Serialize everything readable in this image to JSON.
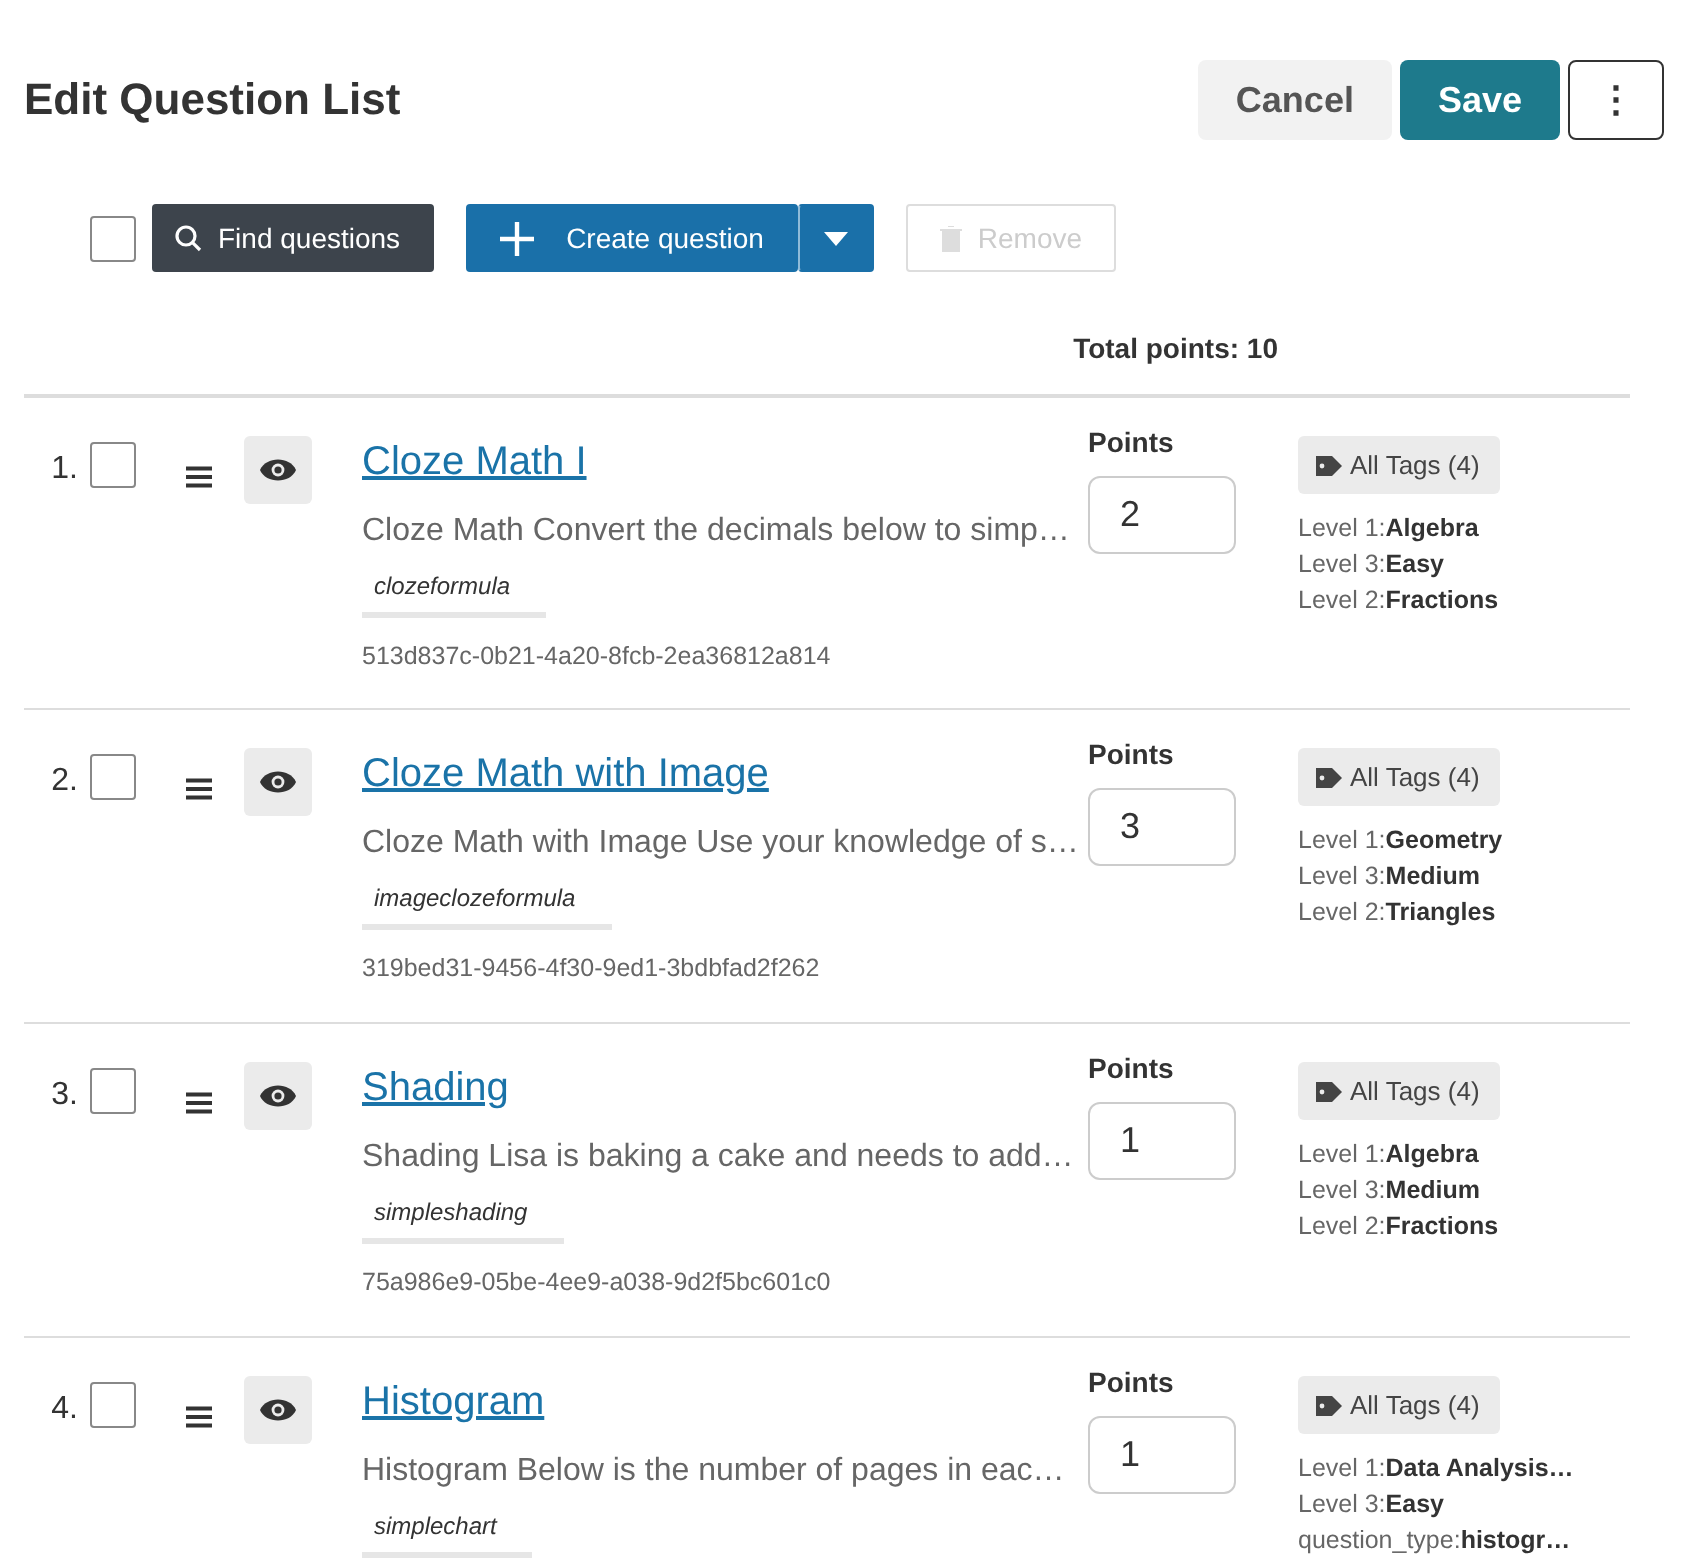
{
  "title": "Edit Question List",
  "header_buttons": [
    {
      "label": "Cancel",
      "kind": "secondary"
    },
    {
      "label": "Save",
      "kind": "primary"
    },
    {
      "label": "⋮",
      "kind": "more"
    }
  ],
  "toolbar": {
    "select_all": {
      "checked": false
    },
    "find": {
      "label": "Find questions"
    },
    "create": {
      "label": "Create question"
    },
    "remove": {
      "label": "Remove",
      "disabled": true
    }
  },
  "total_points": "Total points: 10",
  "questions": [
    {
      "number": "1.",
      "checked": false,
      "title": "Cloze Math I",
      "description": "Cloze Math Convert the decimals below to simp…",
      "type": "clozeformula",
      "id": "513d837c-0b21-4a20-8fcb-2ea36812a814",
      "points_label": "Points",
      "points": "2",
      "tags_button": "All Tags (4)",
      "tags": [
        "Level 1:**Algebra**",
        "Level 3:**Easy**",
        "Level 2:**Fractions**"
      ]
    },
    {
      "number": "2.",
      "checked": false,
      "title": "Cloze Math with Image",
      "description": "Cloze Math with Image Use your knowledge of s…",
      "type": "imageclozeformula",
      "id": "319bed31-9456-4f30-9ed1-3bdbfad2f262",
      "points_label": "Points",
      "points": "3",
      "tags_button": "All Tags (4)",
      "tags": [
        "Level 1:**Geometry**",
        "Level 3:**Medium**",
        "Level 2:**Triangles**"
      ]
    },
    {
      "number": "3.",
      "checked": false,
      "title": "Shading",
      "description": "Shading Lisa is baking a cake and needs to add…",
      "type": "simpleshading",
      "id": "75a986e9-05be-4ee9-a038-9d2f5bc601c0",
      "points_label": "Points",
      "points": "1",
      "tags_button": "All Tags (4)",
      "tags": [
        "Level 1:**Algebra**",
        "Level 3:**Medium**",
        "Level 2:**Fractions**"
      ]
    },
    {
      "number": "4.",
      "checked": false,
      "title": "Histogram",
      "description": "Histogram Below is the number of pages in eac…",
      "type": "simplechart",
      "points_label": "Points",
      "points": "1",
      "tags_button": "All Tags (4)",
      "tags": [
        "Level 1:**Data Analysis…**",
        "Level 3:**Easy**",
        "question_type:**histogr…**"
      ]
    }
  ]
}
